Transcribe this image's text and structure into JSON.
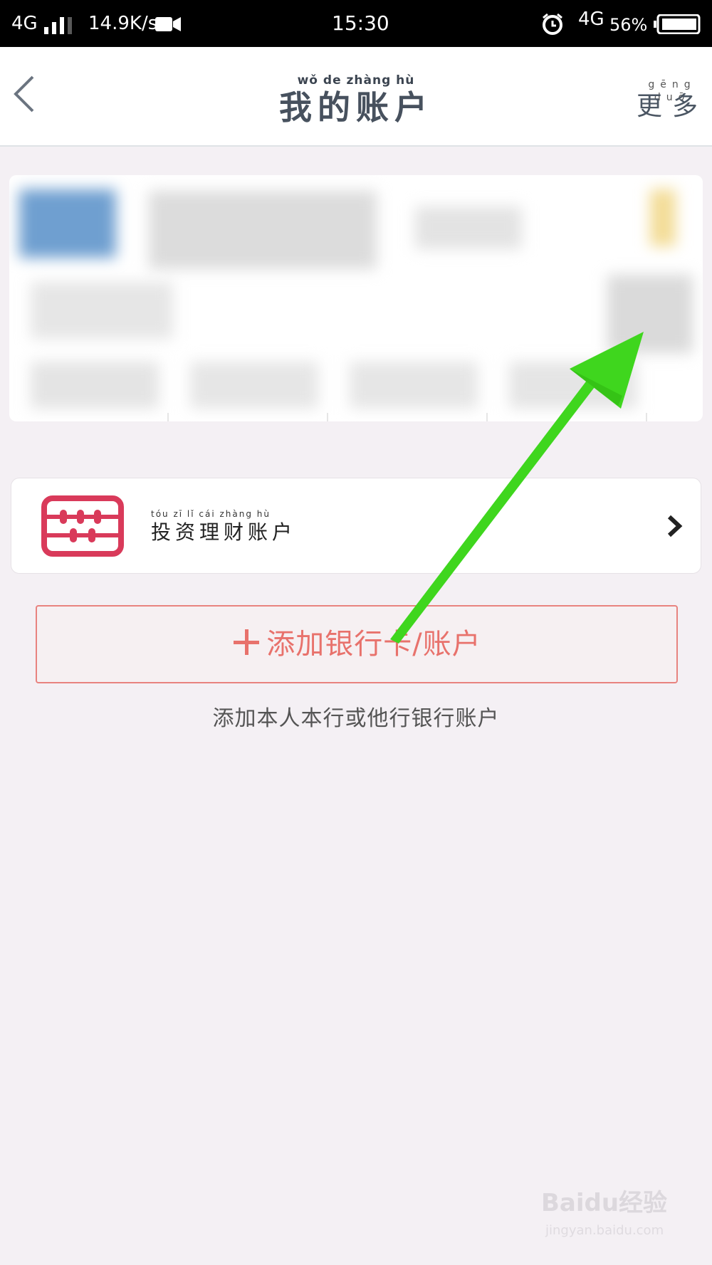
{
  "status_bar": {
    "network_left": "4G",
    "speed": "14.9K/s",
    "time": "15:30",
    "network_right": "4G",
    "battery": "56%"
  },
  "header": {
    "title": "我的账户",
    "title_pinyin": "wǒ de zhàng hù",
    "more_label": "更多",
    "more_pinyin": "gēng duō"
  },
  "invest": {
    "label": "投资理财账户",
    "pinyin": "tóu zī lǐ cái zhàng hù",
    "icon_color": "#d93a5a"
  },
  "add_account": {
    "label": "添加银行卡/账户",
    "hint": "添加本人本行或他行银行账户",
    "accent": "#e8726c"
  },
  "annotation": {
    "arrow_color": "#3fd61e"
  },
  "watermark": {
    "brand": "Baidu经验",
    "url": "jingyan.baidu.com"
  }
}
